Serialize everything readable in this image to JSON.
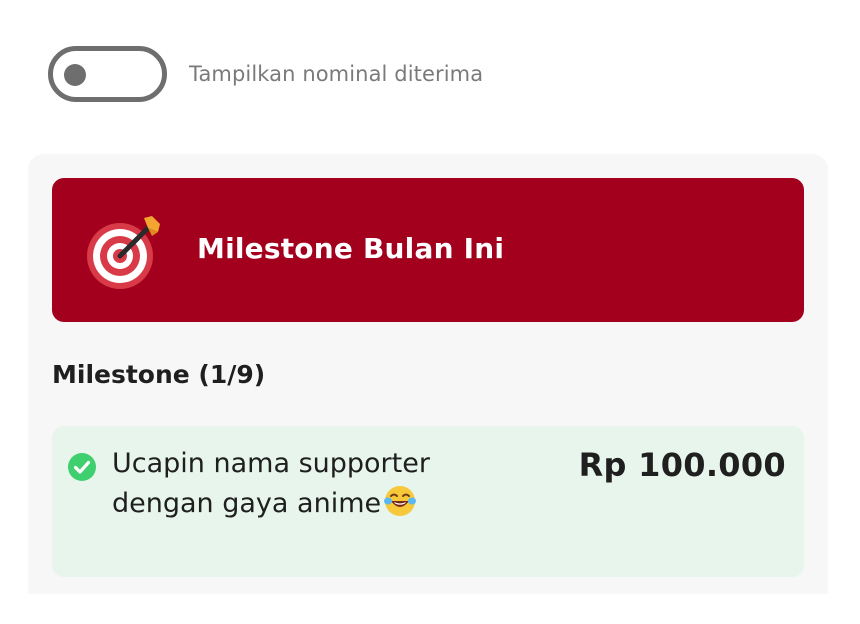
{
  "toggle": {
    "label": "Tampilkan nominal diterima",
    "checked": false
  },
  "banner": {
    "icon": "target-dart-icon",
    "title": "Milestone Bulan Ini",
    "color": "#a2001d"
  },
  "milestones": {
    "heading": "Milestone (1/9)",
    "items": [
      {
        "text": "Ucapin nama supporter dengan gaya anime",
        "emoji": "laughing-tears-emoji-icon",
        "amount": "Rp 100.000",
        "completed": true,
        "status_color": "#3ecf6e"
      }
    ]
  }
}
